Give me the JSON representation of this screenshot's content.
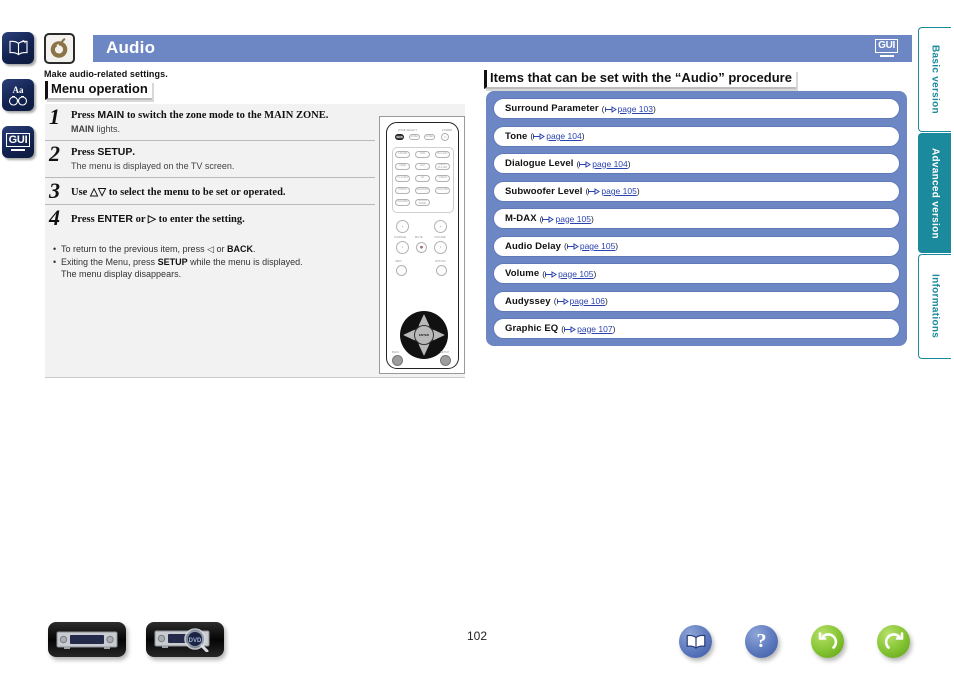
{
  "sidebar": {
    "buttons": [
      {
        "name": "book-icon",
        "label": ""
      },
      {
        "name": "font-size-binoculars-icon",
        "label": "Aa"
      },
      {
        "name": "gui-icon",
        "label": "GUI"
      }
    ]
  },
  "header": {
    "title": "Audio",
    "icon_name": "audio-swirl-icon",
    "gui_badge": "GUI",
    "subtitle": "Make audio-related settings."
  },
  "left_column": {
    "heading": "Menu operation",
    "steps": [
      {
        "number": "1",
        "main_pre": "Press ",
        "main_bold": "MAIN",
        "main_post": " to switch the zone mode to the MAIN ZONE.",
        "sub_bold": "MAIN",
        "sub_post": " lights."
      },
      {
        "number": "2",
        "main_pre": "Press ",
        "main_bold": "SETUP",
        "main_post": ".",
        "sub_bold": "",
        "sub_post": "The menu is displayed on the TV screen."
      },
      {
        "number": "3",
        "main_pre": "Use ",
        "main_bold": "△▽",
        "main_post": " to select the menu to be set or operated.",
        "sub_bold": "",
        "sub_post": ""
      },
      {
        "number": "4",
        "main_pre": "Press ",
        "main_bold": "ENTER",
        "main_post": " or ▷ to enter the setting.",
        "sub_bold": "",
        "sub_post": ""
      }
    ],
    "notes": [
      "To return to the previous item, press ◁ or BACK.",
      "Exiting the Menu, press SETUP while the menu is displayed.",
      "The menu display disappears."
    ]
  },
  "remote": {
    "labels": {
      "zone_select": "ZONE SELECT",
      "power": "POWER",
      "mute": "MUTE",
      "volume": "VOLUME",
      "channel": "CH/PAGE",
      "back": "BACK",
      "setup": "SETUP",
      "info": "INFO",
      "option": "OPTION",
      "enter": "ENTER"
    },
    "zone_buttons": [
      "MAIN",
      "ZONE2",
      "ZONE3",
      "⏻"
    ],
    "source_buttons": [
      "CD/USB",
      "DVD",
      "BLU-RAY",
      "GAME",
      "AUX",
      "MEDIA PLAYER",
      "TV AUDIO",
      "CD",
      "TUNER",
      "PHONO",
      "NETWORK",
      "iPod/USB",
      "INTERNET",
      "SOUND MODE"
    ]
  },
  "right_column": {
    "heading": "Items that can be set with the “Audio” procedure",
    "items": [
      {
        "label": "Surround Parameter",
        "page": "page 103"
      },
      {
        "label": "Tone",
        "page": "page 104"
      },
      {
        "label": "Dialogue Level",
        "page": "page 104"
      },
      {
        "label": "Subwoofer Level",
        "page": "page 105"
      },
      {
        "label": "M-DAX",
        "page": "page 105"
      },
      {
        "label": "Audio Delay",
        "page": "page 105"
      },
      {
        "label": "Volume",
        "page": "page 105"
      },
      {
        "label": "Audyssey",
        "page": "page 106"
      },
      {
        "label": "Graphic EQ",
        "page": "page 107"
      }
    ]
  },
  "vertical_tabs": [
    {
      "label": "Basic version",
      "active": false
    },
    {
      "label": "Advanced version",
      "active": true
    },
    {
      "label": "Informations",
      "active": false
    }
  ],
  "footer": {
    "page_number": "102",
    "device_buttons": [
      {
        "name": "front-panel-icon"
      },
      {
        "name": "display-magnifier-icon",
        "text": "DVD"
      }
    ],
    "nav_buttons": [
      {
        "name": "contents-book-icon",
        "glyph": ""
      },
      {
        "name": "help-question-icon",
        "glyph": "?"
      },
      {
        "name": "back-arrow-icon",
        "glyph": ""
      },
      {
        "name": "forward-arrow-icon",
        "glyph": ""
      }
    ]
  },
  "colors": {
    "header_blue": "#6d86c4",
    "panel_blue": "#6d86c4",
    "tab_teal": "#1b8a9c",
    "link_blue": "#2b43b0",
    "sidebar_navy": "#122250",
    "accent_green": "#83c331"
  }
}
